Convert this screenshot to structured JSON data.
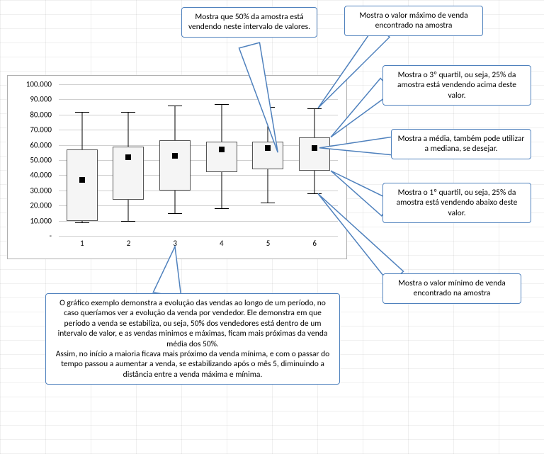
{
  "chart_data": {
    "type": "boxplot",
    "xlabel": "",
    "ylabel": "",
    "ylim": [
      0,
      100000
    ],
    "yticks": [
      0,
      10000,
      20000,
      30000,
      40000,
      50000,
      60000,
      70000,
      80000,
      90000,
      100000
    ],
    "ytick_labels": [
      "-",
      "10.000",
      "20.000",
      "30.000",
      "40.000",
      "50.000",
      "60.000",
      "70.000",
      "80.000",
      "90.000",
      "100.000"
    ],
    "categories": [
      "1",
      "2",
      "3",
      "4",
      "5",
      "6"
    ],
    "series": [
      {
        "min": 9000,
        "q1": 10000,
        "q3": 57000,
        "max": 82000,
        "mean": 37000
      },
      {
        "min": 10000,
        "q1": 24000,
        "q3": 59000,
        "max": 82000,
        "mean": 52000
      },
      {
        "min": 15000,
        "q1": 30000,
        "q3": 63000,
        "max": 86000,
        "mean": 53000
      },
      {
        "min": 18000,
        "q1": 42000,
        "q3": 62000,
        "max": 87000,
        "mean": 57000
      },
      {
        "min": 22000,
        "q1": 44000,
        "q3": 62000,
        "max": 85000,
        "mean": 58000
      },
      {
        "min": 28000,
        "q1": 43000,
        "q3": 65000,
        "max": 84000,
        "mean": 58000
      }
    ]
  },
  "callouts": {
    "iqr": "Mostra que 50% da amostra está vendendo neste intervalo de valores.",
    "max": "Mostra o valor máximo de venda encontrado na amostra",
    "q3": "Mostra o  3º quartil, ou seja, 25% da amostra está vendendo acima deste valor.",
    "mean": "Mostra a média, também pode utilizar a mediana, se desejar.",
    "q1": "Mostra o  1º quartil, ou seja, 25% da amostra está vendendo abaixo deste valor.",
    "min": "Mostra o valor mínimo de venda encontrado na amostra",
    "explain": "O gráfico exemplo demonstra a evolução das vendas ao longo de um período, no caso queríamos ver a evolução da venda por vendedor. Ele demonstra em que período a venda se estabiliza, ou seja, 50% dos vendedores está dentro de um intervalo de valor, e as vendas minimos e máximas, ficam mais próximas da venda média dos 50%.\nAssim, no início a maioria ficava mais próximo da venda mínima, e com o passar do tempo passou a aumentar a venda, se estabilizando após o mês 5, diminuindo a distância entre a venda máxima e mínima."
  }
}
